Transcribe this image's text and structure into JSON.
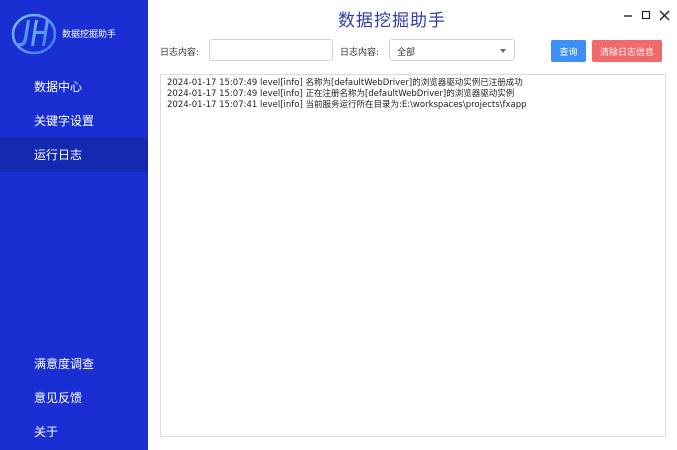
{
  "app": {
    "logo_text": "数据挖掘助手",
    "title": "数据挖掘助手"
  },
  "sidebar": {
    "top_items": [
      {
        "label": "数据中心"
      },
      {
        "label": "关键字设置"
      },
      {
        "label": "运行日志",
        "active": true
      }
    ],
    "bottom_items": [
      {
        "label": "满意度调查"
      },
      {
        "label": "意见反馈"
      },
      {
        "label": "关于"
      }
    ]
  },
  "filters": {
    "log_content_label": "日志内容:",
    "log_content_value": "",
    "log_type_label": "日志内容:",
    "log_type_selected": "全部"
  },
  "buttons": {
    "query": "查询",
    "clear": "清除日志信息"
  },
  "log": {
    "lines": [
      "2024-01-17 15:07:49  level[info]  名称为[defaultWebDriver]的浏览器驱动实例已注册成功",
      "2024-01-17 15:07:49  level[info]  正在注册名称为[defaultWebDriver]的浏览器驱动实例",
      "2024-01-17 15:07:41  level[info]  当前服务运行所在目录为:E:\\workspaces\\projects\\fxapp"
    ]
  },
  "colors": {
    "sidebar_bg": "#1a2fd3",
    "sidebar_active": "#1429b0",
    "title": "#2f3da8",
    "query_btn": "#3d8ff5",
    "clear_btn": "#f06a6a"
  },
  "icons": {
    "logo": "jh-logo-icon",
    "minimize": "minimize-icon",
    "maximize": "maximize-icon",
    "close": "close-icon",
    "select_caret": "chevron-down-icon"
  }
}
